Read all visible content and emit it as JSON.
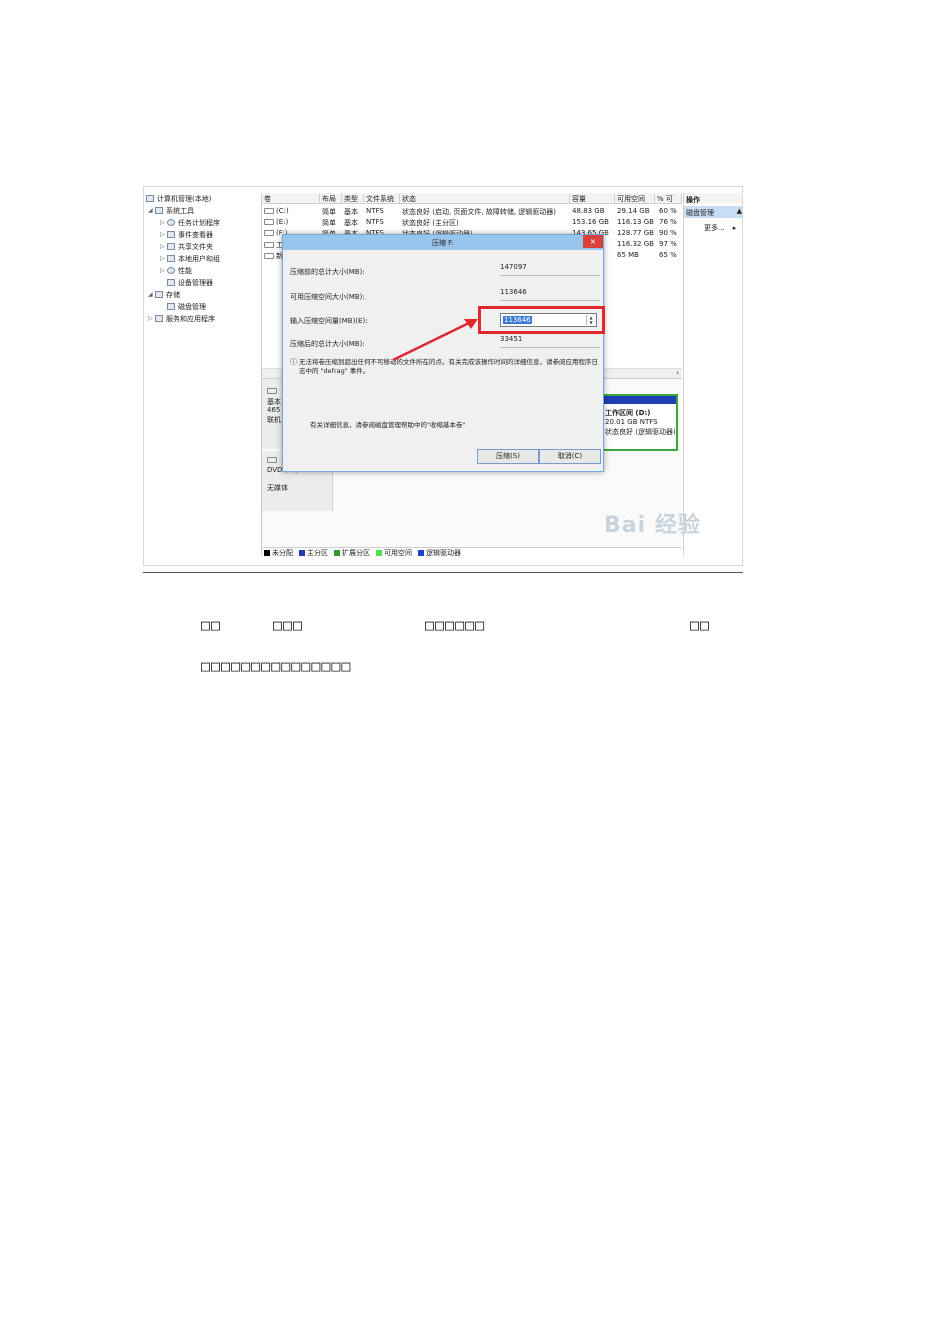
{
  "tree": {
    "root": "计算机管理(本地)",
    "system_tools": "系统工具",
    "task_scheduler": "任务计划程序",
    "event_viewer": "事件查看器",
    "shared_folders": "共享文件夹",
    "local_users": "本地用户和组",
    "performance": "性能",
    "device_manager": "设备管理器",
    "storage": "存储",
    "disk_management": "磁盘管理",
    "services": "服务和应用程序"
  },
  "table": {
    "headers": [
      "卷",
      "布局",
      "类型",
      "文件系统",
      "状态",
      "容量",
      "可用空间",
      "% 可"
    ],
    "rows": [
      [
        "(C:)",
        "简单",
        "基本",
        "NTFS",
        "状态良好 (启动, 页面文件, 故障转储, 逻辑驱动器)",
        "48.83 GB",
        "29.14 GB",
        "60 %"
      ],
      [
        "(E:)",
        "简单",
        "基本",
        "NTFS",
        "状态良好 (主分区)",
        "153.16 GB",
        "116.13 GB",
        "76 %"
      ],
      [
        "(F:)",
        "简单",
        "基本",
        "NTFS",
        "状态良好 (逻辑驱动器)",
        "143.65 GB",
        "128.77 GB",
        "90 %"
      ],
      [
        "工",
        "",
        "",
        "",
        "",
        "",
        "116.32 GB",
        "97 %"
      ],
      [
        "新",
        "",
        "",
        "",
        "",
        "",
        "65 MB",
        "65 %"
      ]
    ]
  },
  "actions": {
    "header": "操作",
    "selected": "磁盘管理",
    "more": "更多..."
  },
  "lower": {
    "disk0_lines": [
      "基本",
      "465",
      "联机"
    ],
    "dvd_label": "DVD (G:)",
    "no_media": "无媒体",
    "part_d_name": "工作区间 (D:)",
    "part_d_size": "20.01 GB NTFS",
    "part_d_status": "状态良好 (逻辑驱动器)"
  },
  "legend": [
    "未分配",
    "主分区",
    "扩展分区",
    "可用空间",
    "逻辑驱动器"
  ],
  "colors": {
    "unallocated": "#000000",
    "primary": "#1e3cb4",
    "extended": "#2f9b2f",
    "free": "#4ee24e",
    "logical": "#1d3fd0",
    "highlight": "#e0282e"
  },
  "dialog": {
    "title": "压缩 F:",
    "close": "×",
    "total_before_label": "压缩前的总计大小(MB):",
    "total_before_value": "147097",
    "available_label": "可用压缩空间大小(MB):",
    "available_value": "113646",
    "input_label": "输入压缩空间量(MB)(E):",
    "input_value": "113646",
    "total_after_label": "压缩后的总计大小(MB):",
    "total_after_value": "33451",
    "note_icon": "ⓘ",
    "note": "无法将卷压缩到超出任何不可移动的文件所在的点。有关完成该操作时间的详细信息，请参阅应用程序日志中的 \"defrag\" 事件。",
    "info": "有关详细信息，请参阅磁盘管理帮助中的\"收缩基本卷\"",
    "shrink_button": "压缩(S)",
    "cancel_button": "取消(C)"
  },
  "watermark": "Bai 经验",
  "paragraph": {
    "line1_parts": [
      "□□",
      "□□□",
      "□□□□□□",
      "□□"
    ],
    "line2": "□□□□□□□□□□□□□□□"
  }
}
